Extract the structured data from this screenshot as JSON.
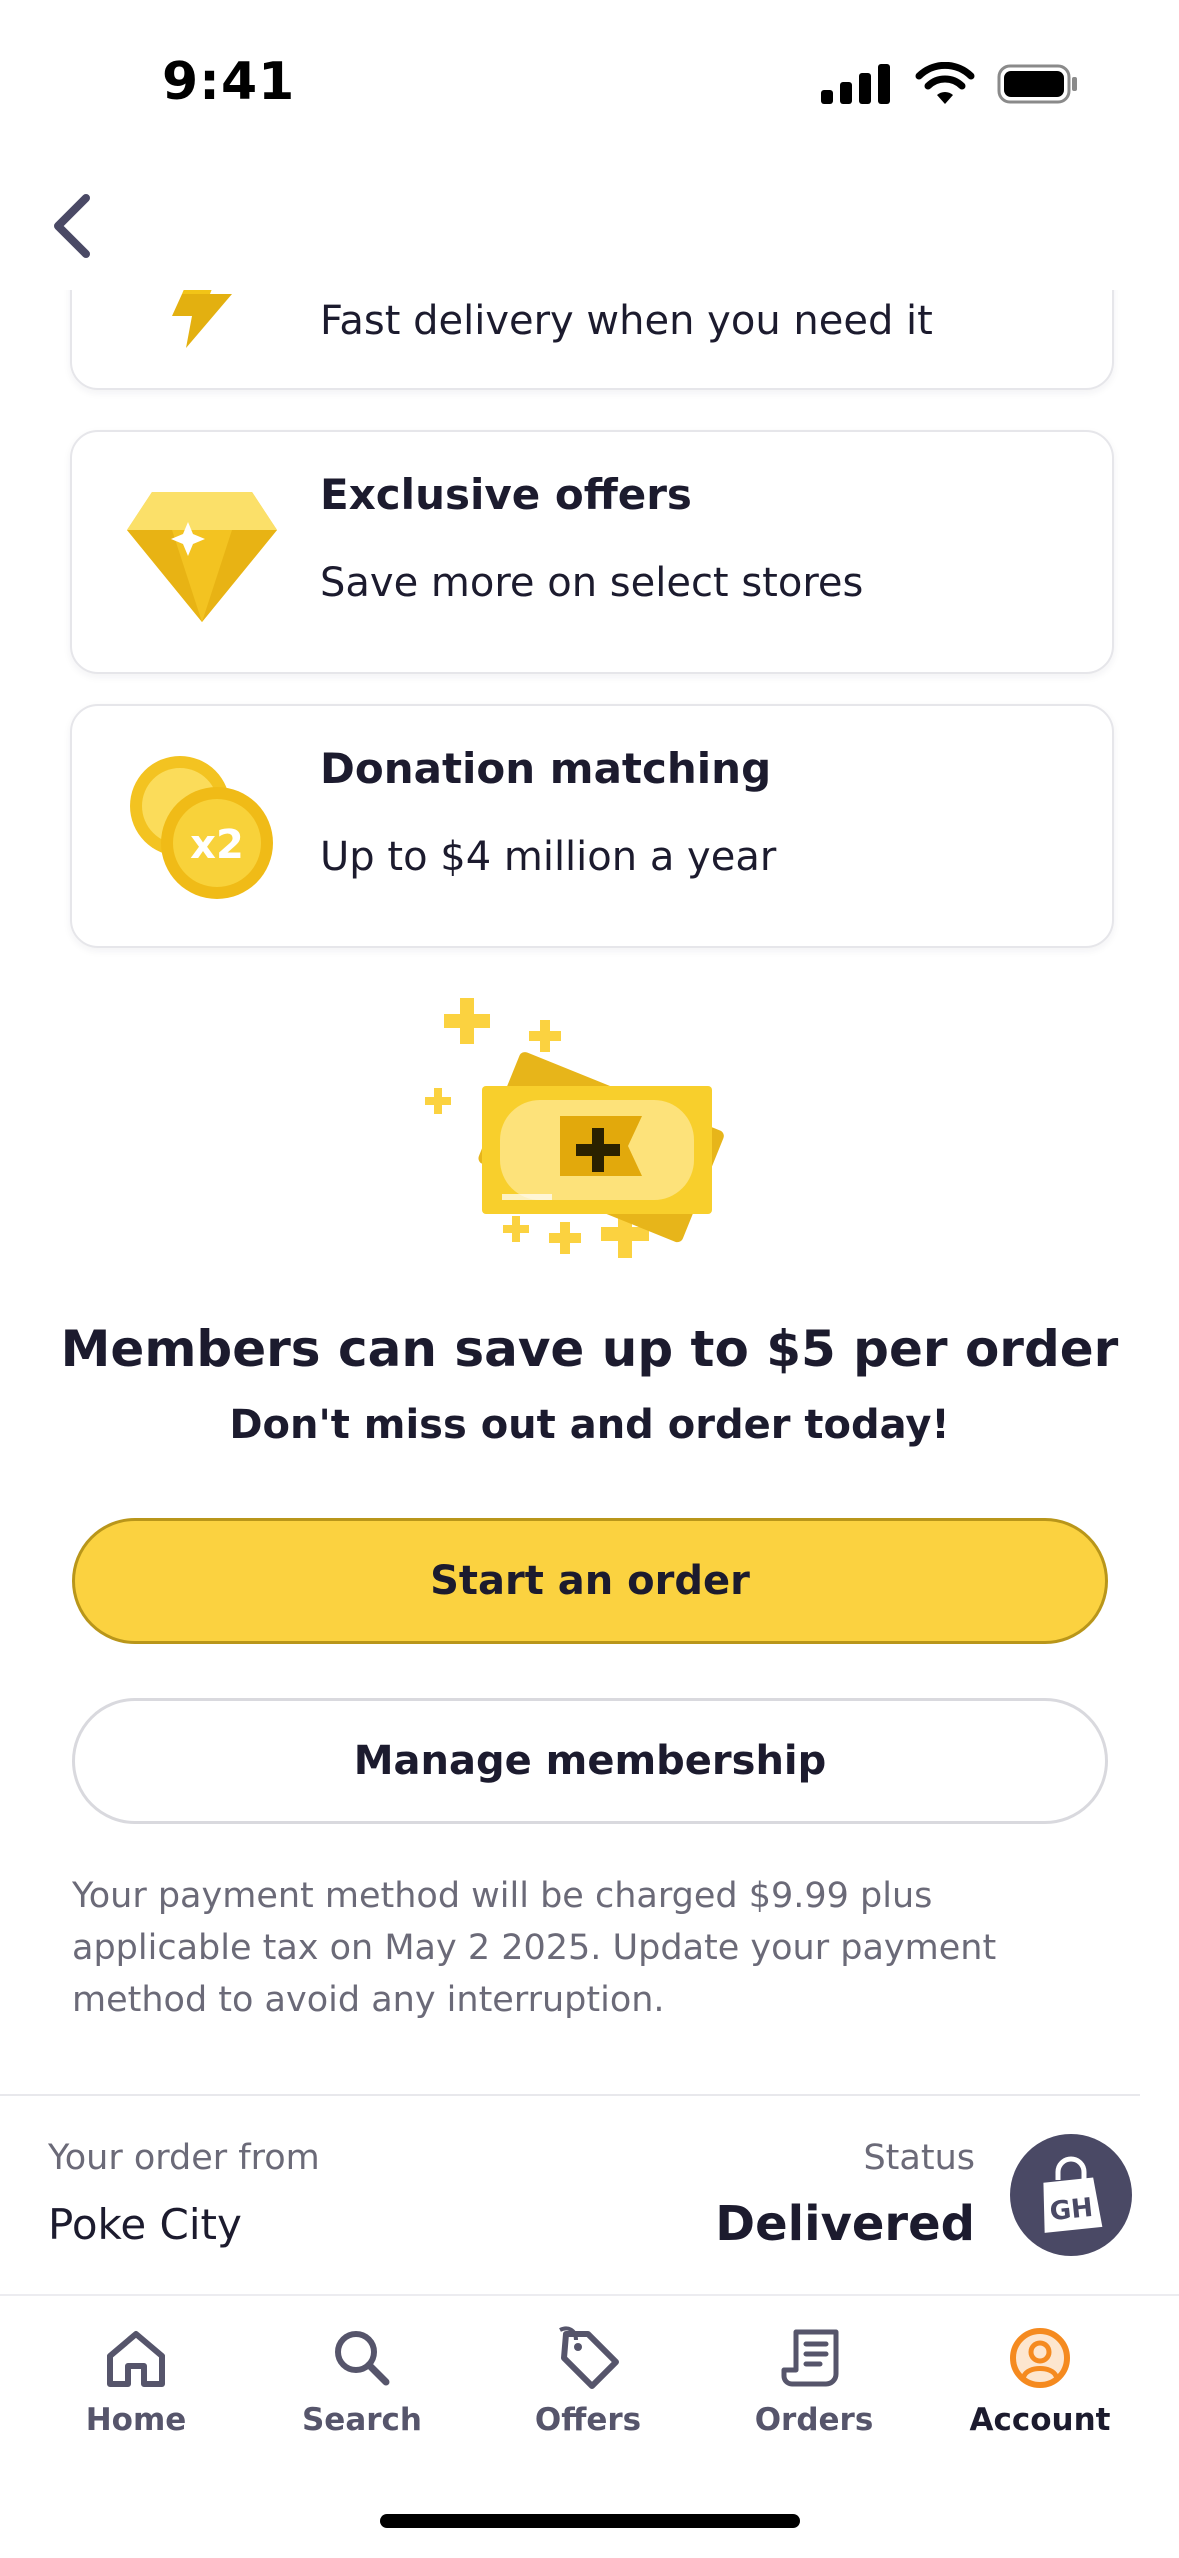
{
  "status_bar": {
    "time": "9:41"
  },
  "benefits": [
    {
      "icon": "lightning-icon",
      "title": "",
      "description": "Fast delivery when you need it"
    },
    {
      "icon": "diamond-icon",
      "title": "Exclusive offers",
      "description": "Save more on select stores"
    },
    {
      "icon": "coins-x2-icon",
      "title": "Donation matching",
      "description": "Up to $4 million a year",
      "badge": "x2"
    }
  ],
  "promo": {
    "headline": "Members can save up to $5 per order",
    "subline": "Don't miss out and order today!"
  },
  "actions": {
    "start_order": "Start an order",
    "manage_membership": "Manage membership"
  },
  "fineprint": "Your payment method will be charged $9.99 plus applicable tax on May 2 2025. Update your payment method to avoid any interruption.",
  "order_banner": {
    "label": "Your order from",
    "store": "Poke City",
    "status_label": "Status",
    "status": "Delivered",
    "badge_text": "GH"
  },
  "tab_bar": {
    "items": [
      {
        "label": "Home",
        "icon": "home-icon"
      },
      {
        "label": "Search",
        "icon": "search-icon"
      },
      {
        "label": "Offers",
        "icon": "tag-icon"
      },
      {
        "label": "Orders",
        "icon": "receipt-icon"
      },
      {
        "label": "Account",
        "icon": "account-icon",
        "active": true
      }
    ]
  },
  "colors": {
    "accent_yellow": "#fbd240",
    "account_orange": "#f58a1f",
    "text_dark": "#1c1b2e",
    "text_muted": "#6b6a78",
    "badge_bg": "#4a4965"
  }
}
